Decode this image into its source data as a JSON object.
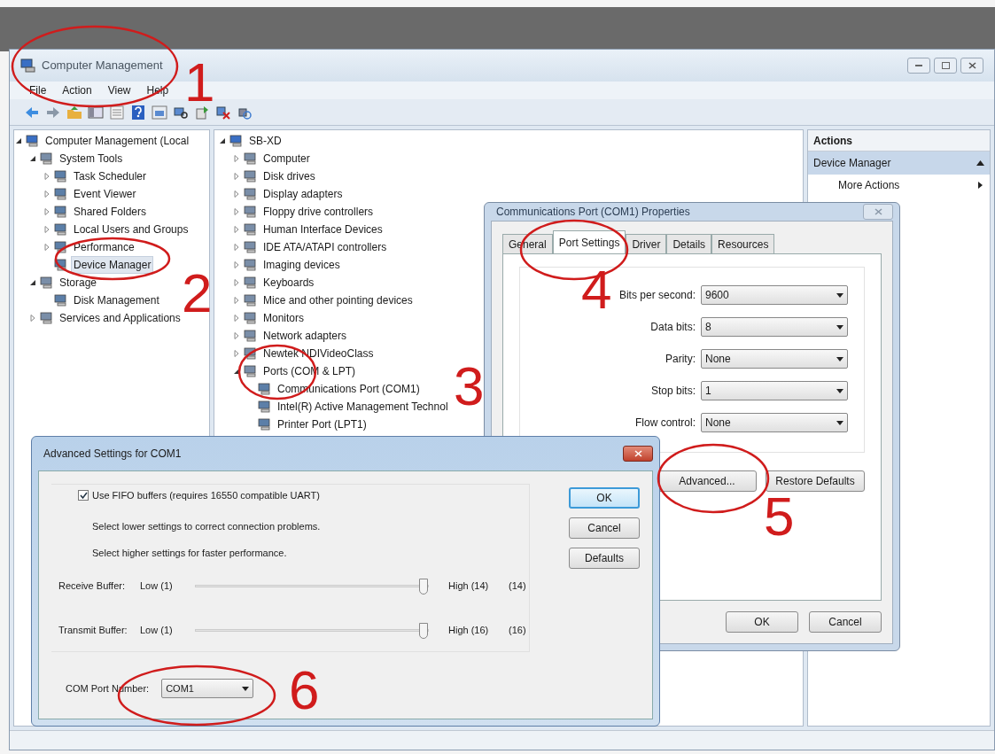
{
  "main_window": {
    "title": "Computer Management",
    "menu": [
      "File",
      "Action",
      "View",
      "Help"
    ],
    "console_tree": [
      {
        "label": "Computer Management (Local",
        "selected": false,
        "expanded": true,
        "children": [
          {
            "label": "System Tools",
            "selected": false,
            "expanded": true,
            "children": [
              {
                "label": "Task Scheduler",
                "selected": false,
                "expanded": false
              },
              {
                "label": "Event Viewer",
                "selected": false,
                "expanded": false
              },
              {
                "label": "Shared Folders",
                "selected": false,
                "expanded": false
              },
              {
                "label": "Local Users and Groups",
                "selected": false,
                "expanded": false
              },
              {
                "label": "Performance",
                "selected": false,
                "expanded": false
              },
              {
                "label": "Device Manager",
                "selected": true
              }
            ]
          },
          {
            "label": "Storage",
            "selected": false,
            "expanded": true,
            "children": [
              {
                "label": "Disk Management",
                "selected": false
              }
            ]
          },
          {
            "label": "Services and Applications",
            "selected": false,
            "expanded": false
          }
        ]
      }
    ],
    "device_tree": [
      {
        "label": "SB-XD",
        "expanded": true,
        "children": [
          {
            "label": "Computer",
            "expanded": false
          },
          {
            "label": "Disk drives",
            "expanded": false
          },
          {
            "label": "Display adapters",
            "expanded": false
          },
          {
            "label": "Floppy drive controllers",
            "expanded": false
          },
          {
            "label": "Human Interface Devices",
            "expanded": false
          },
          {
            "label": "IDE ATA/ATAPI controllers",
            "expanded": false
          },
          {
            "label": "Imaging devices",
            "expanded": false
          },
          {
            "label": "Keyboards",
            "expanded": false
          },
          {
            "label": "Mice and other pointing devices",
            "expanded": false
          },
          {
            "label": "Monitors",
            "expanded": false
          },
          {
            "label": "Network adapters",
            "expanded": false
          },
          {
            "label": "Newtek NDIVideoClass",
            "expanded": false
          },
          {
            "label": "Ports (COM & LPT)",
            "expanded": true,
            "children": [
              {
                "label": "Communications Port (COM1)"
              },
              {
                "label": "Intel(R) Active Management Technol"
              },
              {
                "label": "Printer Port (LPT1)"
              }
            ]
          }
        ]
      }
    ],
    "actions": {
      "header": "Actions",
      "section": "Device Manager",
      "items": [
        "More Actions"
      ]
    }
  },
  "port_properties": {
    "title": "Communications Port (COM1) Properties",
    "tabs": [
      {
        "label": "General",
        "selected": false
      },
      {
        "label": "Port Settings",
        "selected": true
      },
      {
        "label": "Driver",
        "selected": false
      },
      {
        "label": "Details",
        "selected": false
      },
      {
        "label": "Resources",
        "selected": false
      }
    ],
    "settings": [
      {
        "label": "Bits per second:",
        "value": "9600"
      },
      {
        "label": "Data bits:",
        "value": "8"
      },
      {
        "label": "Parity:",
        "value": "None"
      },
      {
        "label": "Stop bits:",
        "value": "1"
      },
      {
        "label": "Flow control:",
        "value": "None"
      }
    ],
    "tab_buttons": [
      "Advanced...",
      "Restore Defaults"
    ],
    "buttons": [
      "OK",
      "Cancel"
    ]
  },
  "advanced_settings": {
    "title": "Advanced Settings for COM1",
    "fifo": {
      "label": "Use FIFO buffers (requires 16550 compatible UART)",
      "checked": true
    },
    "hints": [
      "Select lower settings to correct connection problems.",
      "Select higher settings for faster performance."
    ],
    "buffers": [
      {
        "label": "Receive Buffer:",
        "low": "Low (1)",
        "high": "High (14)",
        "reading": "(14)",
        "level": 1
      },
      {
        "label": "Transmit Buffer:",
        "low": "Low (1)",
        "high": "High (16)",
        "reading": "(16)",
        "level": 1
      }
    ],
    "port_number": {
      "label": "COM Port Number:",
      "value": "COM1"
    },
    "buttons": [
      {
        "label": "OK",
        "default": true
      },
      {
        "label": "Cancel",
        "default": false
      },
      {
        "label": "Defaults",
        "default": false
      }
    ]
  },
  "annotations": [
    "1",
    "2",
    "3",
    "4",
    "5",
    "6"
  ]
}
